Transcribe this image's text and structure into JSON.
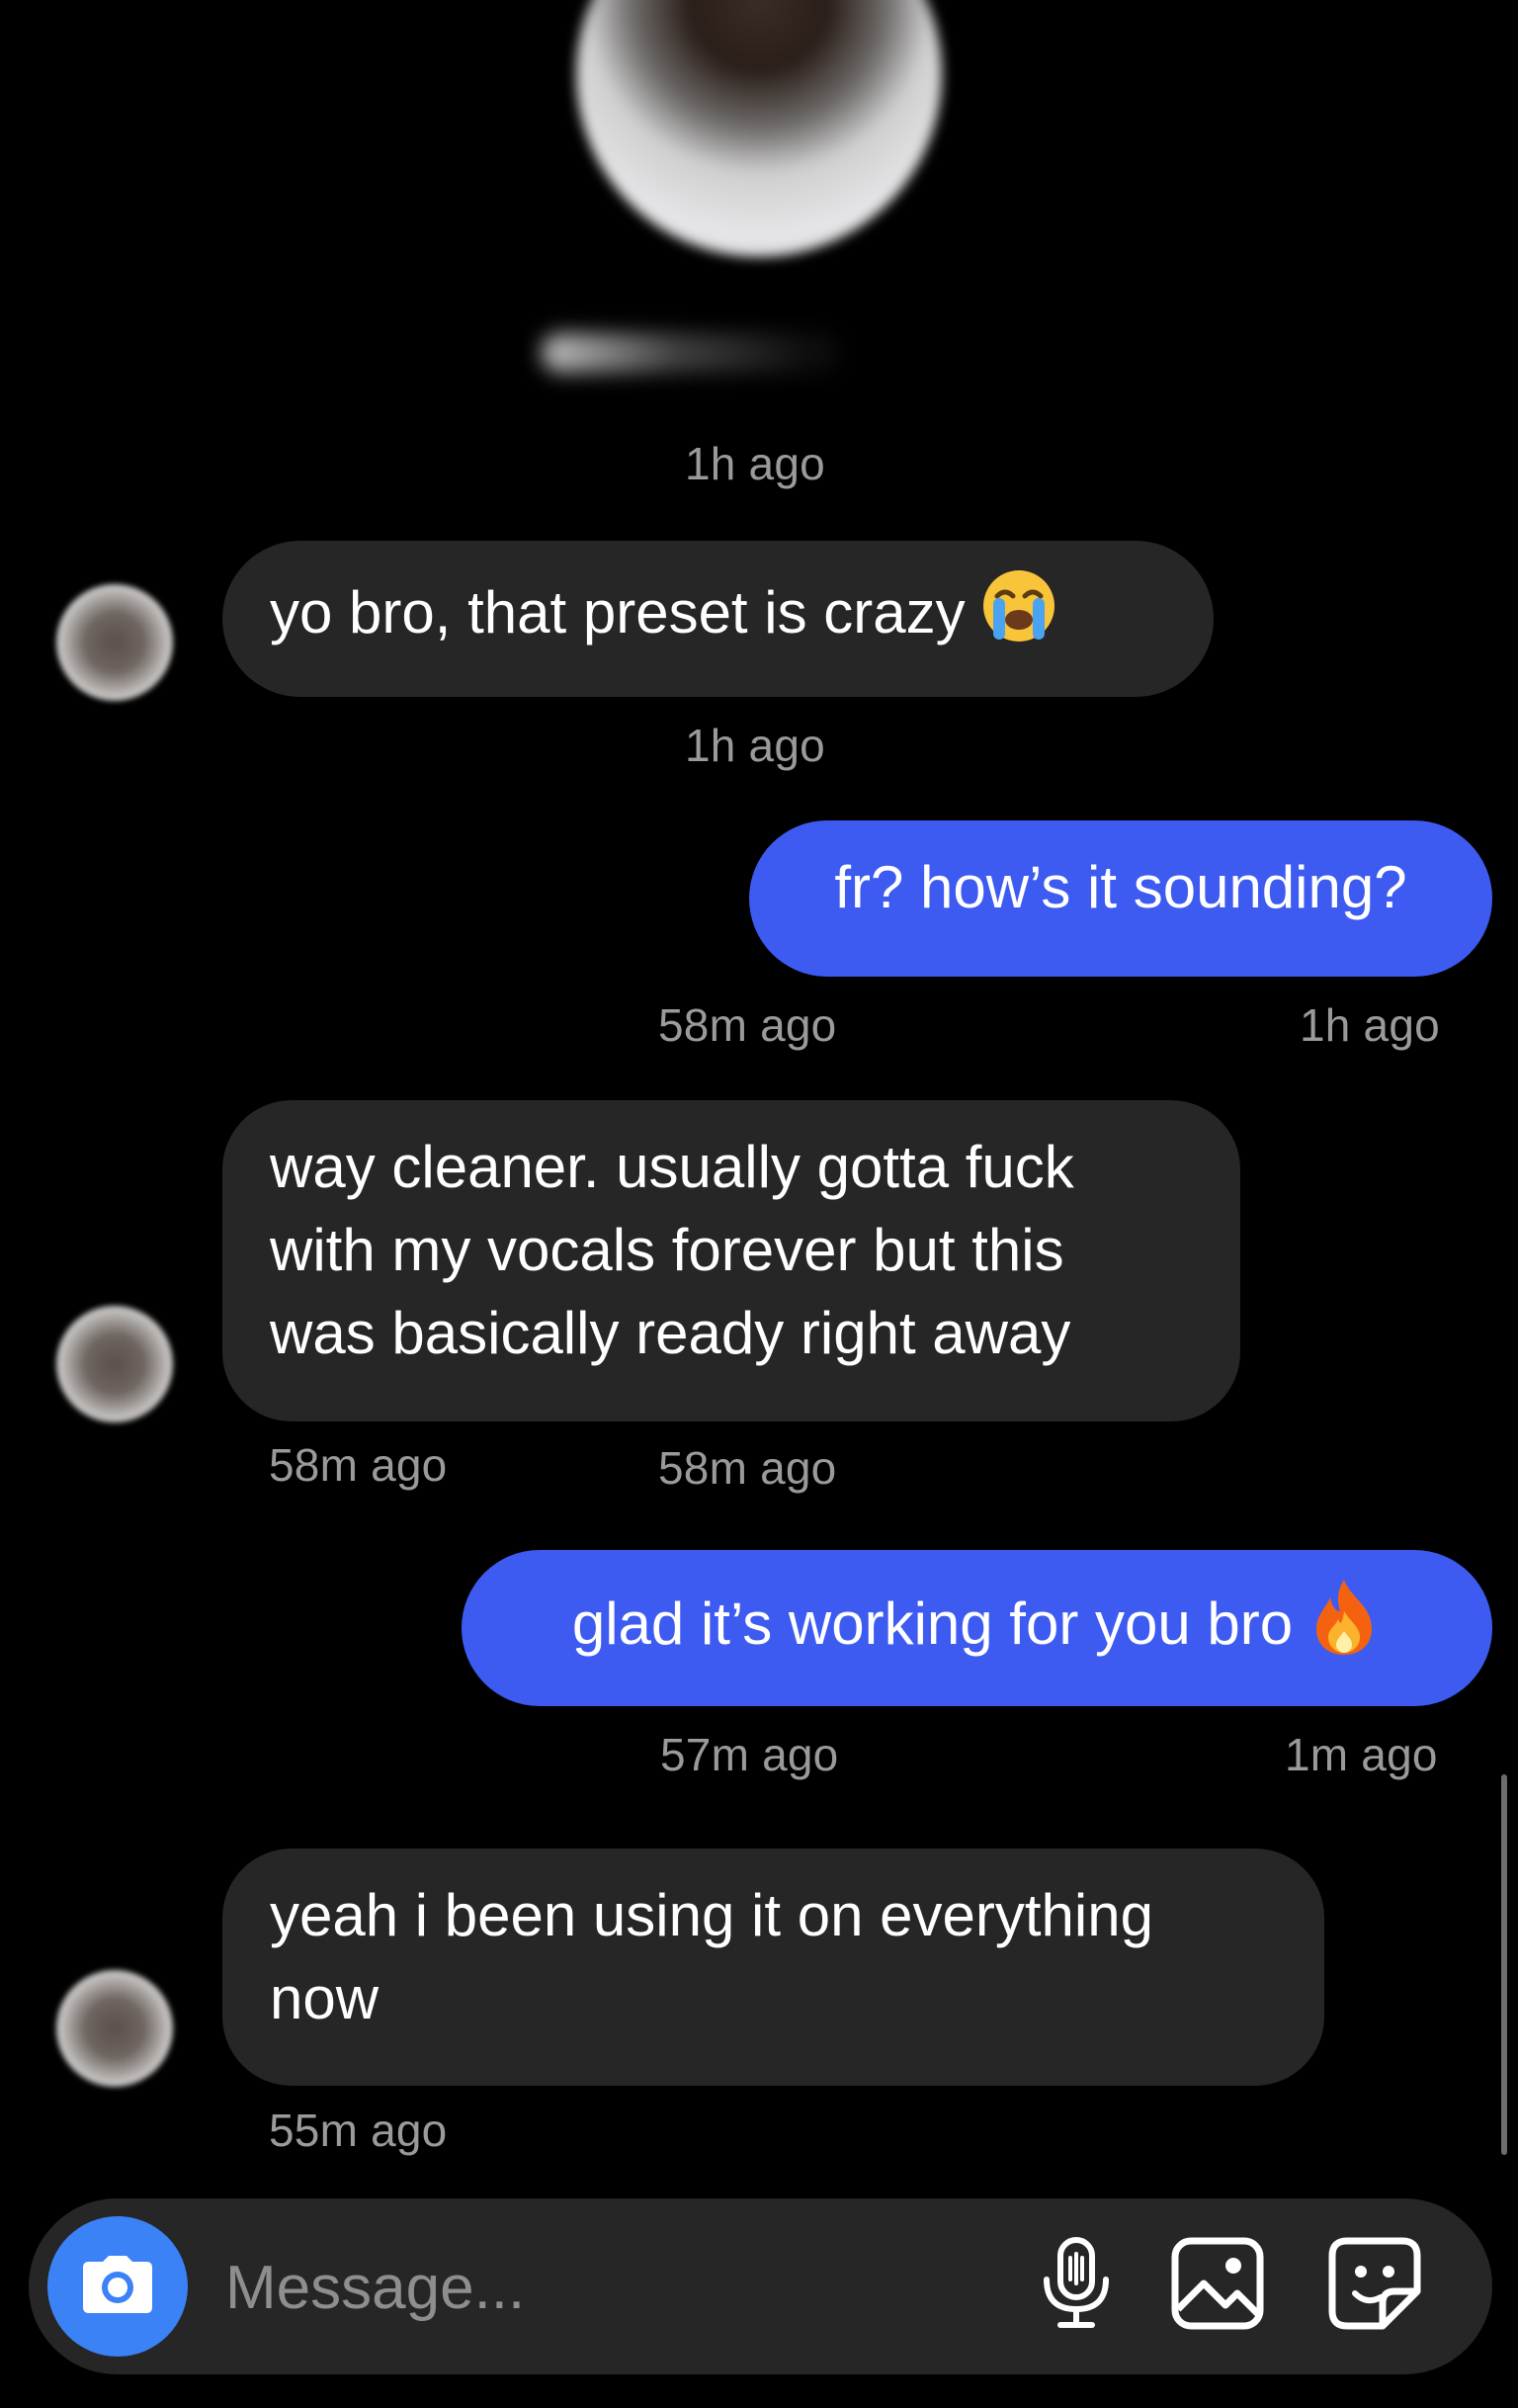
{
  "conversation": {
    "header_timestamp": "1h ago",
    "messages": [
      {
        "direction": "incoming",
        "text": "yo bro, that preset is crazy",
        "emoji": "loudly-crying-face",
        "timestamp": "1h ago"
      },
      {
        "direction": "outgoing",
        "text": "fr? how’s it sounding?",
        "timestamps": [
          "58m ago",
          "1h ago"
        ]
      },
      {
        "direction": "incoming",
        "lines": [
          "way cleaner. usually gotta fuck",
          "with my vocals forever but this",
          "was basically ready right away"
        ],
        "timestamps": [
          "58m ago",
          "58m ago"
        ]
      },
      {
        "direction": "outgoing",
        "text": "glad it’s working for you bro",
        "emoji": "fire",
        "timestamps": [
          "57m ago",
          "1m ago"
        ]
      },
      {
        "direction": "incoming",
        "lines": [
          "yeah i been using it on everything",
          "now"
        ],
        "timestamp": "55m ago"
      }
    ]
  },
  "composer": {
    "placeholder": "Message...",
    "icons": [
      "camera-icon",
      "microphone-icon",
      "gallery-icon",
      "sticker-icon"
    ]
  },
  "colors": {
    "background": "#000000",
    "incoming_bubble": "#262626",
    "outgoing_bubble": "#3e5bf1",
    "camera_button": "#3b82f6",
    "timestamp_text": "#9a9a9a"
  }
}
